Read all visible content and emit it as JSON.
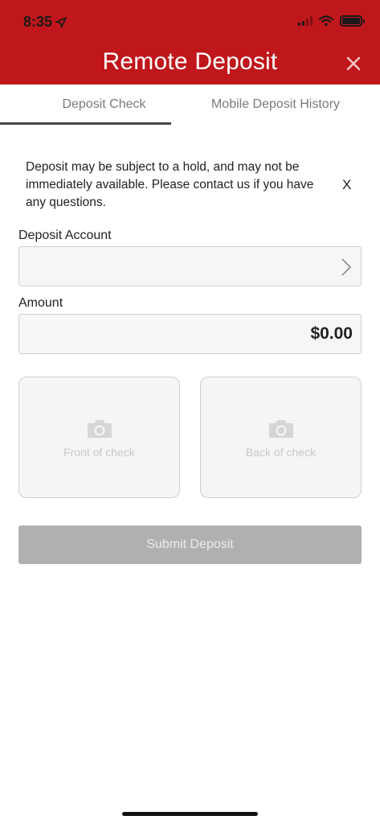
{
  "status_bar": {
    "time": "8:35"
  },
  "header": {
    "title": "Remote Deposit"
  },
  "tabs": [
    {
      "label": "Deposit Check"
    },
    {
      "label": "Mobile Deposit History"
    }
  ],
  "notice": {
    "text": "Deposit may be subject to a hold, and may not be immediately available.  Please contact us if you have any questions.",
    "close_label": "X"
  },
  "deposit_account": {
    "label": "Deposit Account",
    "value": ""
  },
  "amount": {
    "label": "Amount",
    "value": "$0.00"
  },
  "check_images": {
    "front_label": "Front of check",
    "back_label": "Back of check"
  },
  "submit": {
    "label": "Submit Deposit"
  },
  "colors": {
    "header_bg": "#c0171c",
    "submit_disabled": "#b0b0b0"
  },
  "icons": [
    "location-arrow-icon",
    "signal-icon",
    "wifi-icon",
    "battery-icon",
    "close-icon",
    "chevron-right-icon",
    "camera-icon"
  ]
}
